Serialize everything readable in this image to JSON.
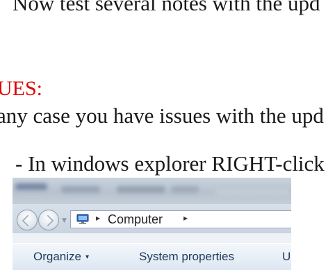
{
  "document": {
    "line_top": "Now test several notes with the upd",
    "issues_heading": "UES:",
    "issues_text": "any case you have issues with the upd",
    "step_text": "- In windows explorer RIGHT-click"
  },
  "explorer": {
    "address": {
      "icon": "computer-icon",
      "separator": "▸",
      "location": "Computer"
    },
    "toolbar": {
      "organize_label": "Organize",
      "organize_caret": "▾",
      "system_properties_label": "System properties",
      "cut_label": "U"
    },
    "colors": {
      "toolbar_text": "#1e395b",
      "issues_heading": "#e00000"
    }
  }
}
